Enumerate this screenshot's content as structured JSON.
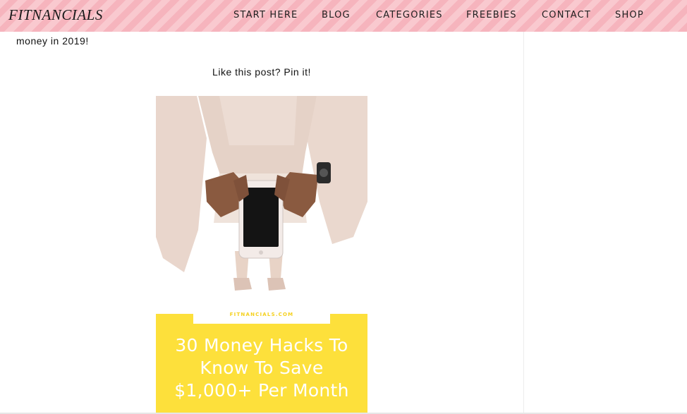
{
  "header": {
    "logo": "FITNANCIALS",
    "nav": [
      "START HERE",
      "BLOG",
      "CATEGORIES",
      "FREEBIES",
      "CONTACT",
      "SHOP"
    ]
  },
  "content": {
    "text_fragment": "money in 2019!",
    "pin_prompt": "Like this post? Pin it!"
  },
  "pin": {
    "site": "FITNANCIALS.COM",
    "headline_lines": [
      "30 Money Hacks To",
      "Know To Save",
      "$1,000+ Per Month"
    ],
    "icon": "woman-holding-phone-image"
  },
  "colors": {
    "header_pink": "#f9c9cf",
    "header_stripe": "#f6b4bd",
    "pin_yellow": "#fde03b"
  }
}
